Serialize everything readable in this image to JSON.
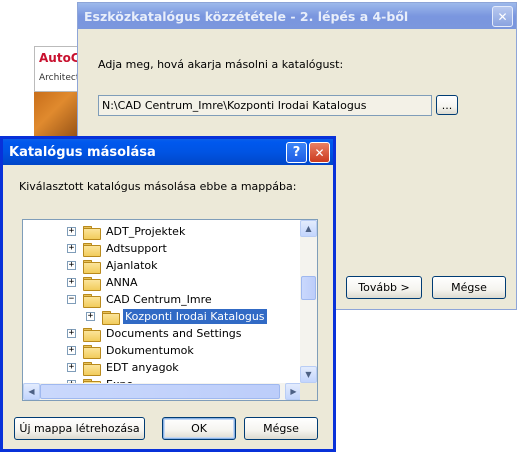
{
  "background_app": {
    "logo_title": "AutoC",
    "logo_subtitle": "Architect"
  },
  "wizard_window": {
    "title": "Eszközkatalógus közzététele - 2. lépés a 4-ből",
    "prompt": "Adja meg, hová akarja másolni a katalógust:",
    "path_value": "N:\\CAD Centrum_Imre\\Kozponti Irodai Katalogus",
    "browse_label": "...",
    "next_label": "Tovább >",
    "cancel_label": "Mégse",
    "close_glyph": "✕"
  },
  "copy_dialog": {
    "title": "Katalógus másolása",
    "help_glyph": "?",
    "close_glyph": "✕",
    "instruction": "Kiválasztott katalógus másolása ebbe a mappába:",
    "tree_items": [
      {
        "label": "ADT_Projektek",
        "expander": "+",
        "selected": false
      },
      {
        "label": "Adtsupport",
        "expander": "+",
        "selected": false
      },
      {
        "label": "Ajanlatok",
        "expander": "+",
        "selected": false
      },
      {
        "label": "ANNA",
        "expander": "+",
        "selected": false
      },
      {
        "label": "CAD Centrum_Imre",
        "expander": "−",
        "selected": false
      },
      {
        "label": "Kozponti Irodai Katalogus",
        "expander": "+",
        "selected": true
      },
      {
        "label": "Documents and Settings",
        "expander": "+",
        "selected": false
      },
      {
        "label": "Dokumentumok",
        "expander": "+",
        "selected": false
      },
      {
        "label": "EDT anyagok",
        "expander": "+",
        "selected": false
      },
      {
        "label": "Expo",
        "expander": "+",
        "selected": false
      }
    ],
    "new_folder_label": "Új mappa létrehozása",
    "ok_label": "OK",
    "cancel_label": "Mégse"
  }
}
